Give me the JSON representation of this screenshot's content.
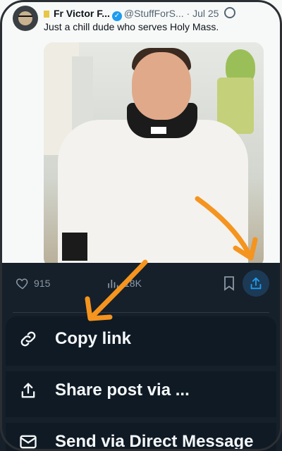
{
  "tweet": {
    "author_name": "Fr Victor F...",
    "handle": "@StuffForS...",
    "separator": "·",
    "date": "Jul 25",
    "text": "Just a chill dude who serves Holy Mass."
  },
  "stats": {
    "likes": "915",
    "views": "18K"
  },
  "share_menu": {
    "items": [
      {
        "label": "Copy link",
        "icon": "link-icon"
      },
      {
        "label": "Share post via ...",
        "icon": "share-icon"
      },
      {
        "label": "Send via Direct Message",
        "icon": "mail-icon"
      }
    ]
  },
  "colors": {
    "sheet_bg": "#15202b",
    "accent": "#1d9bf0",
    "arrow": "#f5941e"
  }
}
